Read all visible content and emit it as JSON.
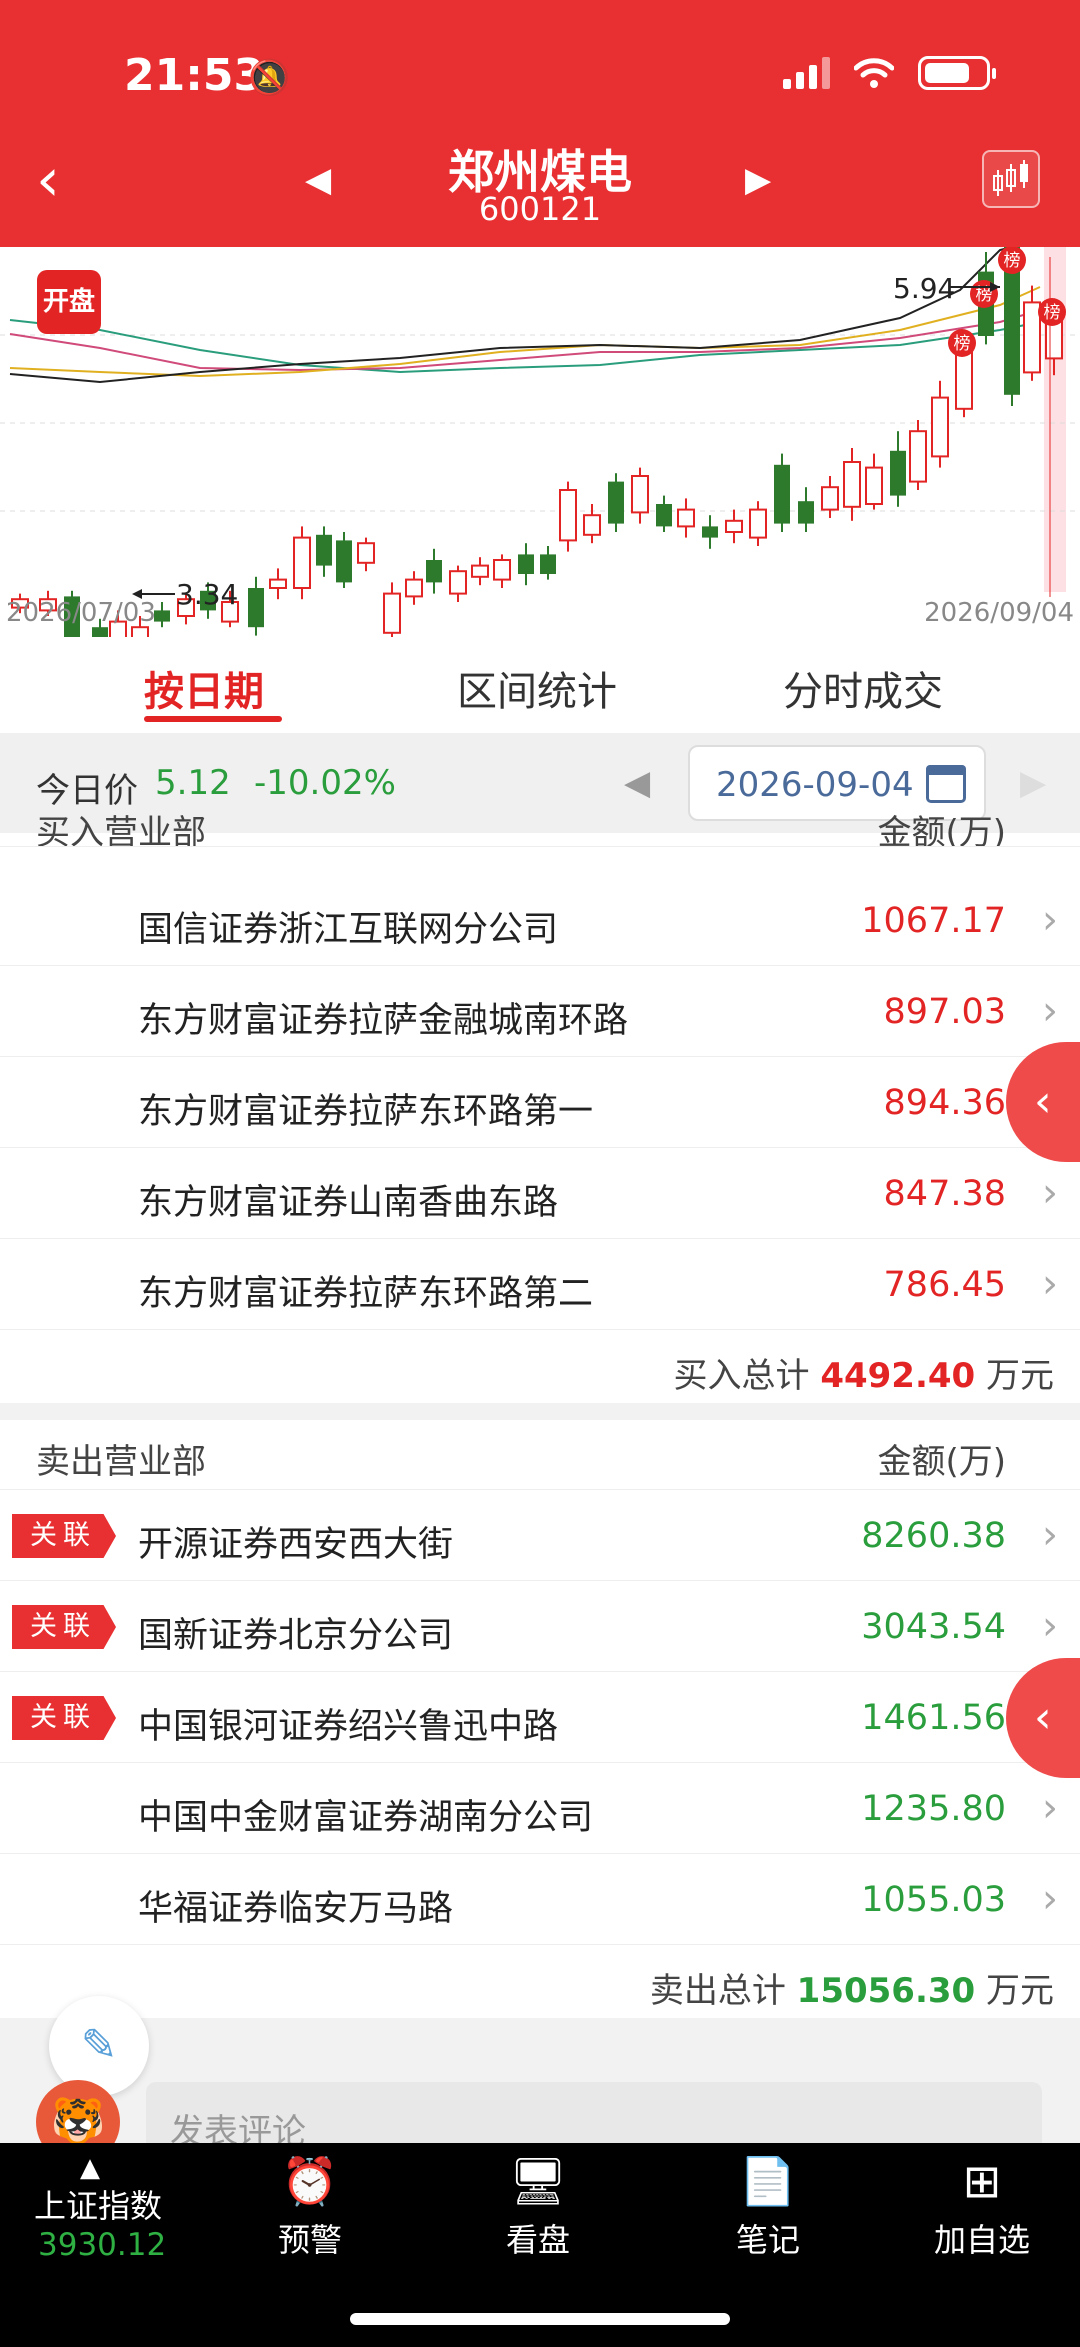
{
  "status_bar": {
    "time": "21:53",
    "bell_icon": "bell-off-icon"
  },
  "header": {
    "title": "郑州煤电",
    "code": "600121",
    "back_icon": "chevron-left-icon",
    "prev_icon": "triangle-left-icon",
    "next_icon": "triangle-right-icon",
    "kline_icon": "candlestick-icon"
  },
  "chart": {
    "badge": "开盘",
    "high_label": "5.94",
    "low_label": "3.34",
    "start_date": "2026/07/03",
    "end_date": "2026/09/04",
    "marker_label": "榜",
    "colors": {
      "up": "#e32424",
      "down": "#2d7a2d"
    }
  },
  "tabs": [
    "按日期",
    "区间统计",
    "分时成交"
  ],
  "price_row": {
    "label": "今日价",
    "price": "5.12",
    "change": "-10.02%",
    "date": "2026-09-04"
  },
  "buy": {
    "header_left": "买入营业部",
    "header_right": "金额(万)",
    "rows": [
      {
        "name": "国信证券浙江互联网分公司",
        "amount": "1067.17"
      },
      {
        "name": "东方财富证券拉萨金融城南环路",
        "amount": "897.03"
      },
      {
        "name": "东方财富证券拉萨东环路第一",
        "amount": "894.36"
      },
      {
        "name": "东方财富证券山南香曲东路",
        "amount": "847.38"
      },
      {
        "name": "东方财富证券拉萨东环路第二",
        "amount": "786.45"
      }
    ],
    "total_label": "买入总计",
    "total_value": "4492.40",
    "total_unit": "万元"
  },
  "sell": {
    "header_left": "卖出营业部",
    "header_right": "金额(万)",
    "rows": [
      {
        "name": "开源证券西安西大街",
        "amount": "8260.38",
        "tag": "关联"
      },
      {
        "name": "国新证券北京分公司",
        "amount": "3043.54",
        "tag": "关联"
      },
      {
        "name": "中国银河证券绍兴鲁迅中路",
        "amount": "1461.56",
        "tag": "关联"
      },
      {
        "name": "中国中金财富证券湖南分公司",
        "amount": "1235.80"
      },
      {
        "name": "华福证券临安万马路",
        "amount": "1055.03"
      }
    ],
    "total_label": "卖出总计",
    "total_value": "15056.30",
    "total_unit": "万元"
  },
  "comment": {
    "placeholder": "发表评论"
  },
  "bottom_nav": {
    "index_name": "上证指数",
    "index_value": "3930.12",
    "items": [
      {
        "label": "预警",
        "icon": "alarm-clock-icon"
      },
      {
        "label": "看盘",
        "icon": "monitor-chart-icon"
      },
      {
        "label": "笔记",
        "icon": "note-icon"
      },
      {
        "label": "加自选",
        "icon": "add-square-icon"
      }
    ]
  }
}
